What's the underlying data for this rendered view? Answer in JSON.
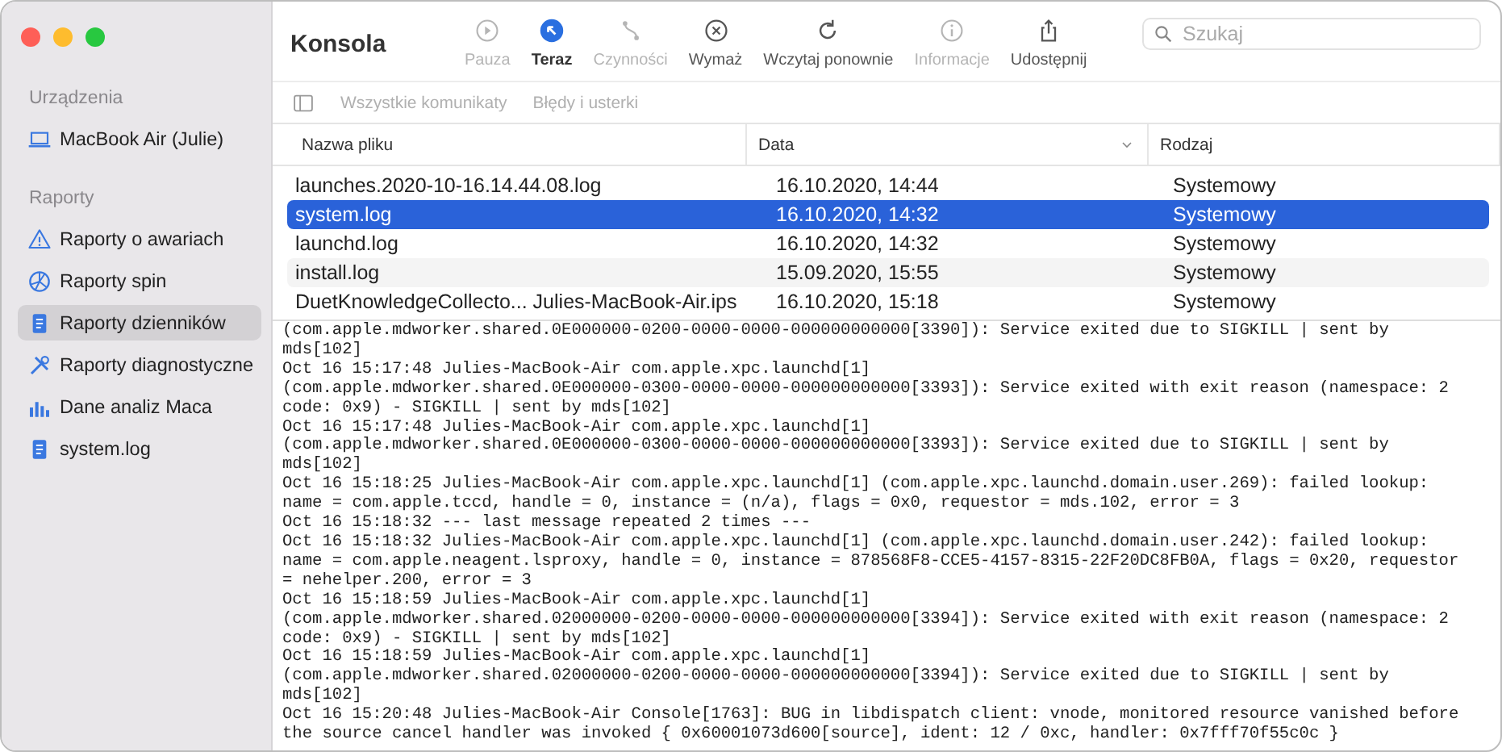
{
  "window": {
    "title": "Konsola"
  },
  "toolbar": [
    {
      "label": "Pauza",
      "kind": "pause",
      "disabled": true,
      "selected": false
    },
    {
      "label": "Teraz",
      "kind": "now",
      "disabled": false,
      "selected": true
    },
    {
      "label": "Czynności",
      "kind": "activities",
      "disabled": true,
      "selected": false
    },
    {
      "label": "Wymaż",
      "kind": "clear",
      "disabled": false,
      "selected": false
    },
    {
      "label": "Wczytaj ponownie",
      "kind": "reload",
      "disabled": false,
      "selected": false
    },
    {
      "label": "Informacje",
      "kind": "info",
      "disabled": true,
      "selected": false
    },
    {
      "label": "Udostępnij",
      "kind": "share",
      "disabled": false,
      "selected": false
    }
  ],
  "search": {
    "placeholder": "Szukaj"
  },
  "filters": [
    {
      "label": "Wszystkie komunikaty",
      "disabled": true
    },
    {
      "label": "Błędy i usterki",
      "disabled": true
    }
  ],
  "sidebar": {
    "sections": [
      {
        "title": "Urządzenia",
        "items": [
          {
            "label": "MacBook Air (Julie)",
            "kind": "laptop",
            "selected": false
          }
        ]
      },
      {
        "title": "Raporty",
        "items": [
          {
            "label": "Raporty o awariach",
            "kind": "warning",
            "selected": false
          },
          {
            "label": "Raporty spin",
            "kind": "spin",
            "selected": false
          },
          {
            "label": "Raporty dzienników",
            "kind": "document",
            "selected": true
          },
          {
            "label": "Raporty diagnostyczne",
            "kind": "tools",
            "selected": false
          },
          {
            "label": "Dane analiz Maca",
            "kind": "chart",
            "selected": false
          },
          {
            "label": "system.log",
            "kind": "document",
            "selected": false
          }
        ]
      }
    ]
  },
  "table": {
    "columns": [
      {
        "label": "Nazwa pliku",
        "sorted": false
      },
      {
        "label": "Data",
        "sorted": true
      },
      {
        "label": "Rodzaj",
        "sorted": false
      }
    ],
    "rows": [
      {
        "cells": [
          "launches.2020-10-16.14.44.08.log",
          "16.10.2020, 14:44",
          "Systemowy"
        ],
        "selected": false
      },
      {
        "cells": [
          "system.log",
          "16.10.2020, 14:32",
          "Systemowy"
        ],
        "selected": true
      },
      {
        "cells": [
          "launchd.log",
          "16.10.2020, 14:32",
          "Systemowy"
        ],
        "selected": false
      },
      {
        "cells": [
          "install.log",
          "15.09.2020, 15:55",
          "Systemowy"
        ],
        "selected": false
      },
      {
        "cells": [
          "DuetKnowledgeCollecto... Julies-MacBook-Air.ips",
          "16.10.2020, 15:18",
          "Systemowy"
        ],
        "selected": false
      }
    ]
  },
  "log": {
    "lines": [
      "(com.apple.mdworker.shared.0E000000-0200-0000-0000-000000000000[3390]): Service exited due to SIGKILL | sent by",
      "mds[102]",
      "Oct 16 15:17:48 Julies-MacBook-Air com.apple.xpc.launchd[1]",
      "(com.apple.mdworker.shared.0E000000-0300-0000-0000-000000000000[3393]): Service exited with exit reason (namespace: 2",
      "code: 0x9) - SIGKILL | sent by mds[102]",
      "Oct 16 15:17:48 Julies-MacBook-Air com.apple.xpc.launchd[1]",
      "(com.apple.mdworker.shared.0E000000-0300-0000-0000-000000000000[3393]): Service exited due to SIGKILL | sent by",
      "mds[102]",
      "Oct 16 15:18:25 Julies-MacBook-Air com.apple.xpc.launchd[1] (com.apple.xpc.launchd.domain.user.269): failed lookup:",
      "name = com.apple.tccd, handle = 0, instance = (n/a), flags = 0x0, requestor = mds.102, error = 3",
      "Oct 16 15:18:32 --- last message repeated 2 times ---",
      "Oct 16 15:18:32 Julies-MacBook-Air com.apple.xpc.launchd[1] (com.apple.xpc.launchd.domain.user.242): failed lookup:",
      "name = com.apple.neagent.lsproxy, handle = 0, instance = 878568F8-CCE5-4157-8315-22F20DC8FB0A, flags = 0x20, requestor",
      "= nehelper.200, error = 3",
      "Oct 16 15:18:59 Julies-MacBook-Air com.apple.xpc.launchd[1]",
      "(com.apple.mdworker.shared.02000000-0200-0000-0000-000000000000[3394]): Service exited with exit reason (namespace: 2",
      "code: 0x9) - SIGKILL | sent by mds[102]",
      "Oct 16 15:18:59 Julies-MacBook-Air com.apple.xpc.launchd[1]",
      "(com.apple.mdworker.shared.02000000-0200-0000-0000-000000000000[3394]): Service exited due to SIGKILL | sent by",
      "mds[102]",
      "Oct 16 15:20:48 Julies-MacBook-Air Console[1763]: BUG in libdispatch client: vnode, monitored resource vanished before",
      "the source cancel handler was invoked { 0x60001073d600[source], ident: 12 / 0xc, handler: 0x7fff70f55c0c }"
    ]
  }
}
